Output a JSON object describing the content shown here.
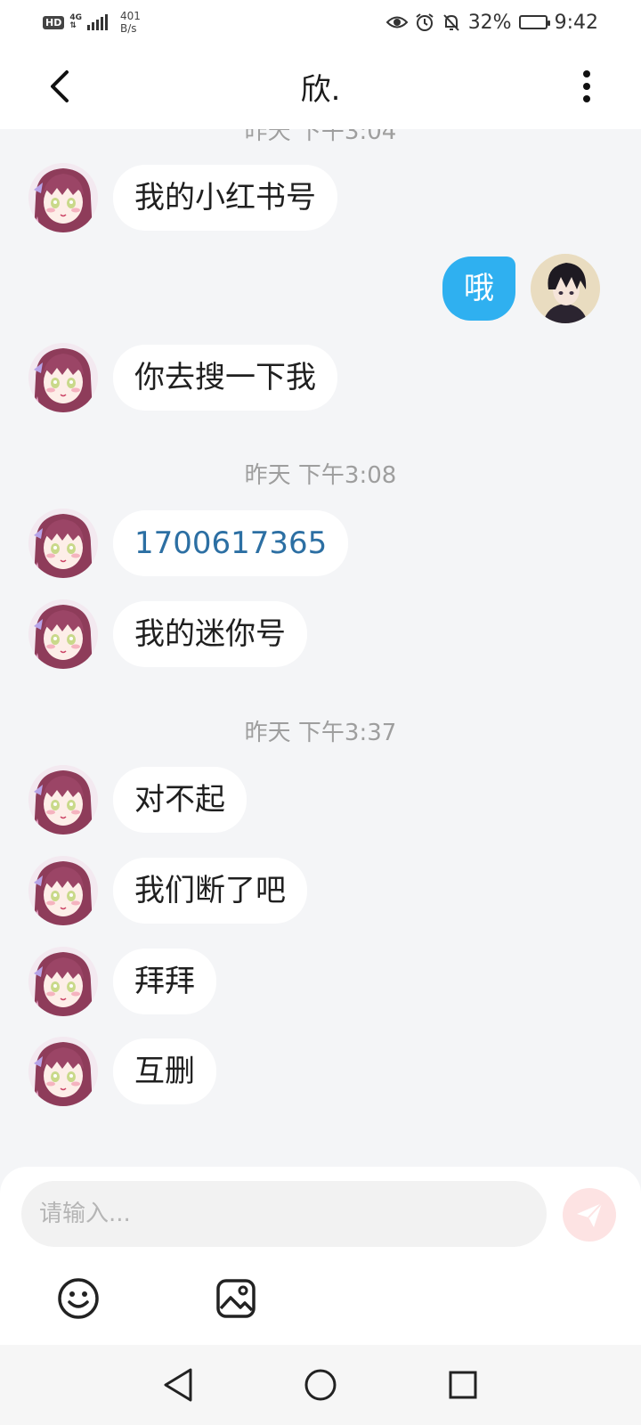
{
  "status_bar": {
    "hd": "HD",
    "network": "4G",
    "speed_value": "401",
    "speed_unit": "B/s",
    "battery": "32%",
    "battery_level": 0.32,
    "time": "9:42"
  },
  "header": {
    "title": "欣.",
    "back_icon": "chevron-left-icon",
    "more_icon": "vertical-dots-icon"
  },
  "chat": {
    "top_timestamp_partial": "昨天 下午3:04",
    "messages_group1": [
      {
        "from": "other",
        "text": "我的小红书号"
      },
      {
        "from": "me",
        "text": "哦"
      },
      {
        "from": "other",
        "text": "你去搜一下我"
      }
    ],
    "timestamp2": "昨天 下午3:08",
    "messages_group2": [
      {
        "from": "other",
        "text": "1700617365"
      },
      {
        "from": "other",
        "text": "我的迷你号"
      }
    ],
    "timestamp3": "昨天 下午3:37",
    "messages_group3": [
      {
        "from": "other",
        "text": "对不起"
      },
      {
        "from": "other",
        "text": "我们断了吧"
      },
      {
        "from": "other",
        "text": "拜拜"
      },
      {
        "from": "other",
        "text": "互删"
      }
    ]
  },
  "composer": {
    "placeholder": "请输入...",
    "send_icon": "paper-plane-icon",
    "emoji_icon": "smiley-icon",
    "image_icon": "image-icon",
    "send_color": "#fde3e3"
  },
  "colors": {
    "my_bubble": "#2fb0f0",
    "link_text": "#2c6fa3"
  }
}
